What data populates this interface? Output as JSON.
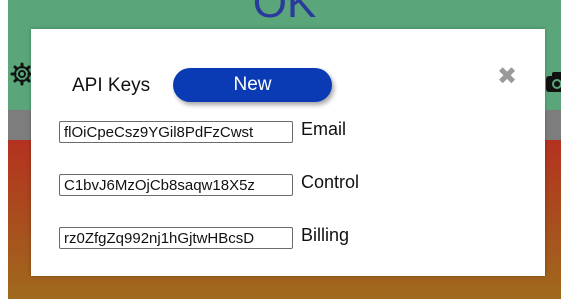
{
  "background": {
    "title": "OK",
    "colors": {
      "top": "#5aa67a",
      "band": "#7d7d7d",
      "bottom_start": "#b5321f",
      "bottom_end": "#a06a1d",
      "title": "#2a3a9c"
    },
    "left_icon": "gear-icon",
    "right_icon": "camera-icon"
  },
  "modal": {
    "title": "API Keys",
    "new_button": "New",
    "close": "✖",
    "accent": "#0a3bb5",
    "keys": [
      {
        "value": "flOiCpeCsz9YGil8PdFzCwst",
        "label": "Email"
      },
      {
        "value": "C1bvJ6MzOjCb8saqw18X5z",
        "label": "Control"
      },
      {
        "value": "rz0ZfgZq992nj1hGjtwHBcsD",
        "label": "Billing"
      }
    ]
  }
}
